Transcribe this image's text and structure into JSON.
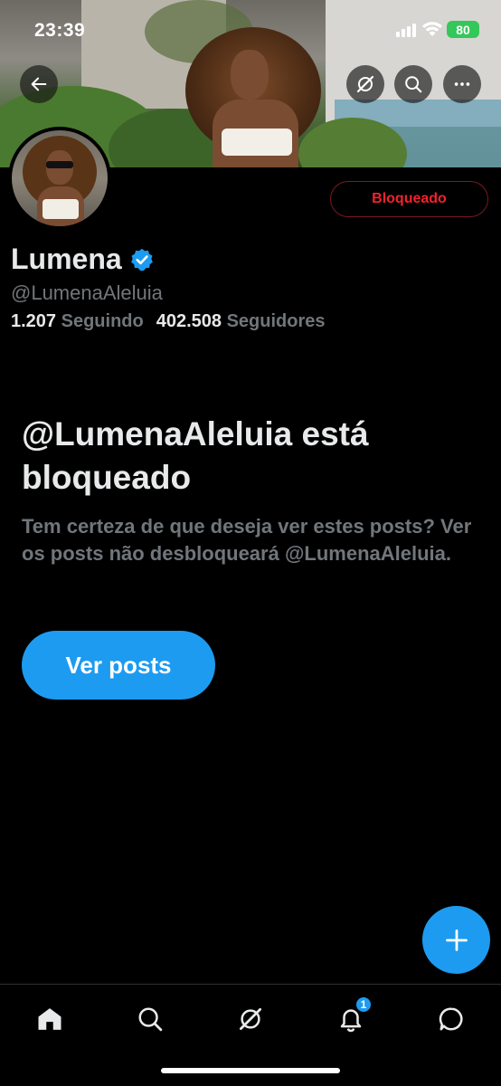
{
  "status_bar": {
    "time": "23:39",
    "battery": "80"
  },
  "profile": {
    "blocked_label": "Bloqueado",
    "display_name": "Lumena",
    "handle": "@LumenaAleluia",
    "following_count": "1.207",
    "following_label": "Seguindo",
    "followers_count": "402.508",
    "followers_label": "Seguidores"
  },
  "blocked_notice": {
    "title": "@LumenaAleluia está bloqueado",
    "description": "Tem certeza de que deseja ver estes posts? Ver os posts não desbloqueará @LumenaAleluia.",
    "button_label": "Ver posts"
  },
  "tab_bar": {
    "items": [
      {
        "icon": "home-icon"
      },
      {
        "icon": "search-icon"
      },
      {
        "icon": "grok-icon"
      },
      {
        "icon": "bell-icon",
        "badge": "1"
      },
      {
        "icon": "message-icon"
      }
    ]
  },
  "colors": {
    "accent": "#1d9bf0",
    "blocked_red": "#f4212e",
    "verified": "#1d9bf0"
  }
}
